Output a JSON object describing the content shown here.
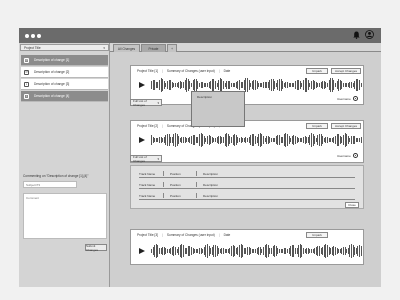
{
  "window": {
    "controls": [
      "close",
      "minimize",
      "maximize"
    ]
  },
  "sidebar": {
    "project_select": "Project Title",
    "items": [
      {
        "label": "Description of change [1]",
        "state": "active",
        "icon": "arrow-icon"
      },
      {
        "label": "Description of change [2]",
        "state": "plain",
        "icon": "arrow-icon"
      },
      {
        "label": "Description of change [3]",
        "state": "plain",
        "icon": "square-icon"
      },
      {
        "label": "Description of change [4]",
        "state": "active",
        "icon": "square-icon"
      }
    ],
    "comment_label": "Commenting on \"Description of change [1],[4]\"",
    "subject_placeholder": "Subject/Ttl",
    "comment_placeholder": "Comment",
    "submit_label": "Submit Changes"
  },
  "tabs": [
    {
      "label": "All Changes"
    },
    {
      "label": "Private"
    },
    {
      "label": "+"
    }
  ],
  "cards": [
    {
      "title": "Project Title [1]",
      "summary": "Summary of Changes (user input)",
      "date": "Date",
      "btn1": "Unpark",
      "btn2": "Accept Changes",
      "username": "Username",
      "dropdown": "Full List of Changes"
    },
    {
      "title": "Project Title [2]",
      "summary": "Summary of Changes (user input)",
      "date": "Date",
      "btn1": "Unpark",
      "btn2": "Accept Changes",
      "username": "Username",
      "dropdown": "Full List of Changes"
    },
    {
      "title": "Project Title [3]",
      "summary": "Summary of Changes (user input)",
      "date": "Date",
      "btn1": "Unpark"
    }
  ],
  "description_popup": {
    "label": "Description"
  },
  "changes_table": {
    "rows": [
      {
        "track": "Track Name",
        "position": "Position",
        "description": "Description"
      },
      {
        "track": "Track Name",
        "position": "Position",
        "description": "Description"
      },
      {
        "track": "Track Name",
        "position": "Position",
        "description": "Description"
      }
    ],
    "close_label": "Close"
  },
  "colors": {
    "chrome": "#6b6b6b",
    "panel": "#cfcfcf",
    "selected": "#8c8c8c",
    "background": "#f1f1f1"
  }
}
